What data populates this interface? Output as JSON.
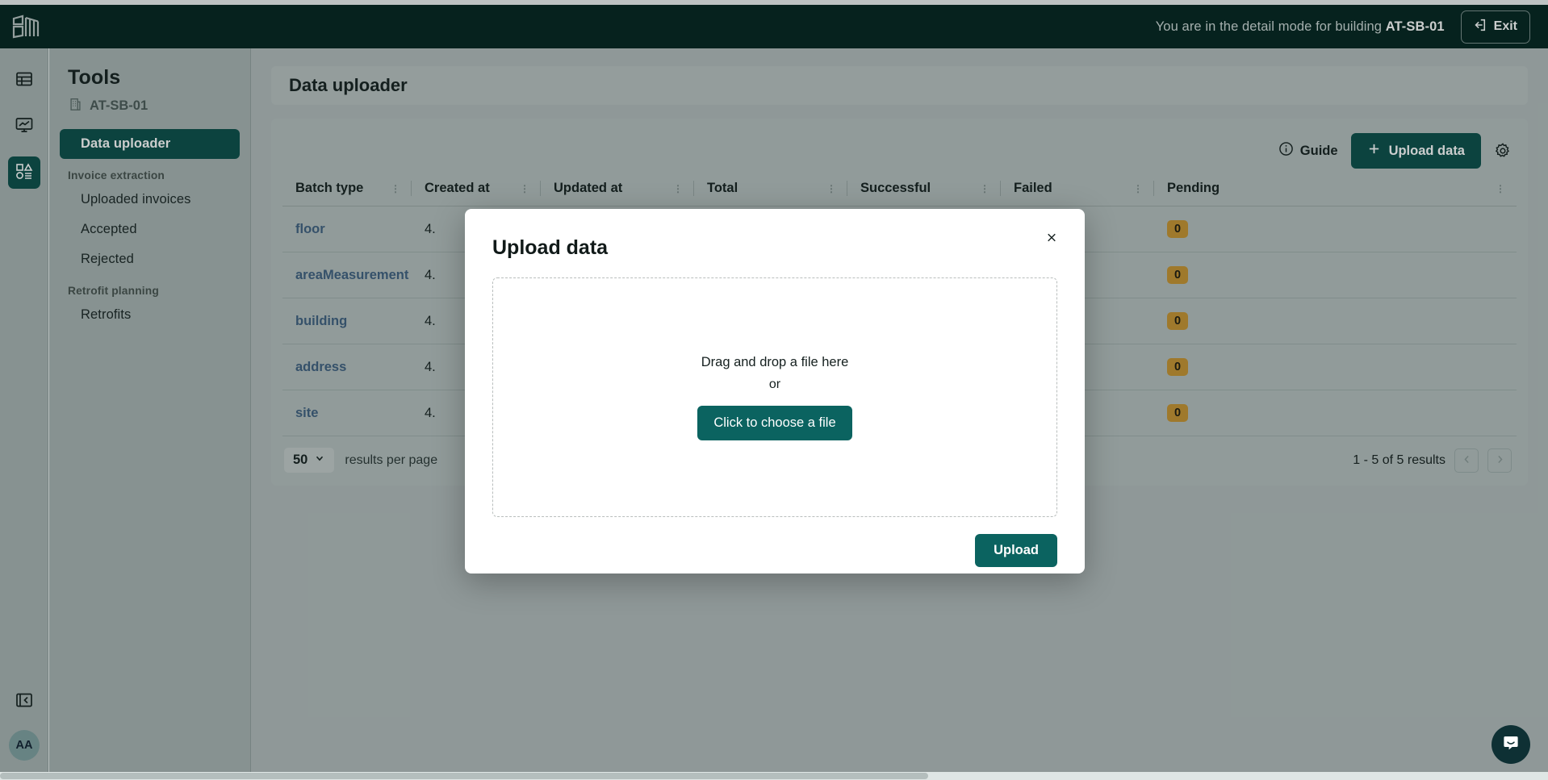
{
  "topbar": {
    "logo_icon": "building-logo-icon",
    "detail_message_prefix": "You are in the detail mode for building ",
    "detail_building": "AT-SB-01",
    "exit_label": "Exit",
    "exit_icon": "exit-arrow-icon"
  },
  "rail": {
    "items": [
      {
        "icon": "table-grid-icon",
        "active": false
      },
      {
        "icon": "monitor-chart-icon",
        "active": false
      },
      {
        "icon": "shapes-list-icon",
        "active": true
      }
    ],
    "collapse_icon": "collapse-sidebar-icon",
    "avatar_initials": "AA"
  },
  "tools": {
    "title": "Tools",
    "building_icon": "building-small-icon",
    "building_label": "AT-SB-01",
    "items": [
      {
        "label": "Data uploader",
        "type": "item",
        "active": true
      },
      {
        "label": "Invoice extraction",
        "type": "group"
      },
      {
        "label": "Uploaded invoices",
        "type": "item",
        "active": false
      },
      {
        "label": "Accepted",
        "type": "item",
        "active": false
      },
      {
        "label": "Rejected",
        "type": "item",
        "active": false
      },
      {
        "label": "Retrofit planning",
        "type": "group"
      },
      {
        "label": "Retrofits",
        "type": "item",
        "active": false
      }
    ]
  },
  "page": {
    "title": "Data uploader"
  },
  "toolbar": {
    "guide_label": "Guide",
    "guide_icon": "info-circle-icon",
    "upload_data_label": "Upload data",
    "upload_data_icon": "plus-icon",
    "settings_icon": "gear-icon"
  },
  "table": {
    "columns": [
      "Batch type",
      "Created at",
      "Updated at",
      "Total",
      "Successful",
      "Failed",
      "Pending"
    ],
    "rows": [
      {
        "batch_type": "floor",
        "created_at": "4.",
        "updated_at": "",
        "total": "",
        "successful": "",
        "failed": "",
        "pending": "0"
      },
      {
        "batch_type": "areaMeasurement",
        "created_at": "4.",
        "updated_at": "",
        "total": "",
        "successful": "",
        "failed": "",
        "pending": "0"
      },
      {
        "batch_type": "building",
        "created_at": "4.",
        "updated_at": "",
        "total": "",
        "successful": "",
        "failed": "",
        "pending": "0"
      },
      {
        "batch_type": "address",
        "created_at": "4.",
        "updated_at": "",
        "total": "",
        "successful": "",
        "failed": "",
        "pending": "0"
      },
      {
        "batch_type": "site",
        "created_at": "4.",
        "updated_at": "",
        "total": "",
        "successful": "",
        "failed": "",
        "pending": "0"
      }
    ]
  },
  "footer": {
    "per_page_value": "50",
    "per_page_caret": "chevron-down-icon",
    "per_page_label": "results per page",
    "results_text": "1 -  5 of  5 results",
    "prev_icon": "chevron-left-icon",
    "next_icon": "chevron-right-icon"
  },
  "modal": {
    "title": "Upload data",
    "close_icon": "close-icon",
    "dropzone_text": "Drag and drop a file here",
    "dropzone_or": "or",
    "choose_file_label": "Click to choose a file",
    "upload_label": "Upload"
  },
  "chat": {
    "icon": "chat-bubble-icon"
  },
  "colors": {
    "brand_dark": "#03251f",
    "brand_teal": "#0b4f4a",
    "accent_teal": "#0b6360",
    "badge_amber": "#c79431",
    "link_blue": "#3f6080"
  }
}
